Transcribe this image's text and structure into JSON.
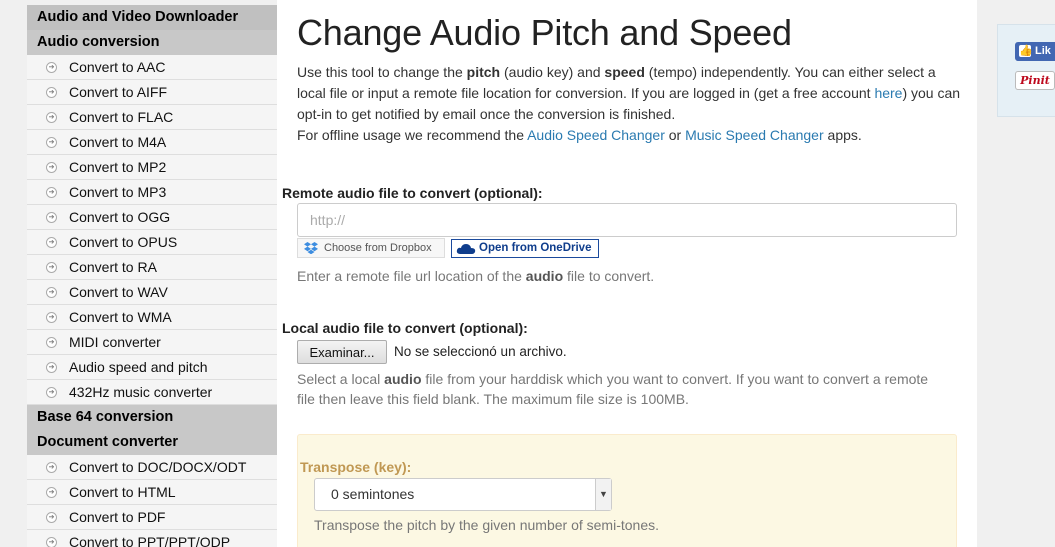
{
  "sidebar": {
    "sections": [
      {
        "title": "Audio and Video Downloader",
        "items": []
      },
      {
        "title": "Audio conversion",
        "items": [
          "Convert to AAC",
          "Convert to AIFF",
          "Convert to FLAC",
          "Convert to M4A",
          "Convert to MP2",
          "Convert to MP3",
          "Convert to OGG",
          "Convert to OPUS",
          "Convert to RA",
          "Convert to WAV",
          "Convert to WMA",
          "MIDI converter",
          "Audio speed and pitch",
          "432Hz music converter"
        ]
      },
      {
        "title": "Base 64 conversion",
        "items": []
      },
      {
        "title": "Document converter",
        "items": [
          "Convert to DOC/DOCX/ODT",
          "Convert to HTML",
          "Convert to PDF",
          "Convert to PPT/PPT/ODP"
        ]
      }
    ]
  },
  "main": {
    "title": "Change Audio Pitch and Speed",
    "intro": {
      "p1_a": "Use this tool to change the ",
      "p1_pitch": "pitch",
      "p1_b": " (audio key) and ",
      "p1_speed": "speed",
      "p1_c": " (tempo) independently. You can either select a local file or input a remote file location for conversion. If you are logged in (get a free account ",
      "p1_link": "here",
      "p1_d": ") you can opt-in to get notified by email once the conversion is finished.",
      "p2_a": "For offline usage we recommend the ",
      "p2_link1": "Audio Speed Changer",
      "p2_b": " or ",
      "p2_link2": "Music Speed Changer",
      "p2_c": " apps."
    },
    "remote": {
      "label": "Remote audio file to convert (optional):",
      "placeholder": "http://",
      "dropbox_label": "Choose from Dropbox",
      "onedrive_label": "Open from OneDrive",
      "help_a": "Enter a remote file url location of the ",
      "help_b": "audio",
      "help_c": " file to convert."
    },
    "local": {
      "label": "Local audio file to convert (optional):",
      "button": "Examinar...",
      "status": "No se seleccionó un archivo.",
      "help_a": "Select a local ",
      "help_b": "audio",
      "help_c": " file from your harddisk which you want to convert. If you want to convert a remote",
      "help_d": "file then leave this field blank. The maximum file size is 100MB."
    },
    "options": {
      "transpose_label": "Transpose (key):",
      "transpose_value": "0 semintones",
      "transpose_help": "Transpose the pitch by the given number of semi-tones."
    }
  },
  "social": {
    "fb_label": "Lik",
    "pin_label": "Pinit"
  },
  "colors": {
    "link": "#2a7ab0",
    "options_bg": "#fcf8e3",
    "options_label": "#c09853",
    "sidebar_header": "#c8c8c8"
  }
}
